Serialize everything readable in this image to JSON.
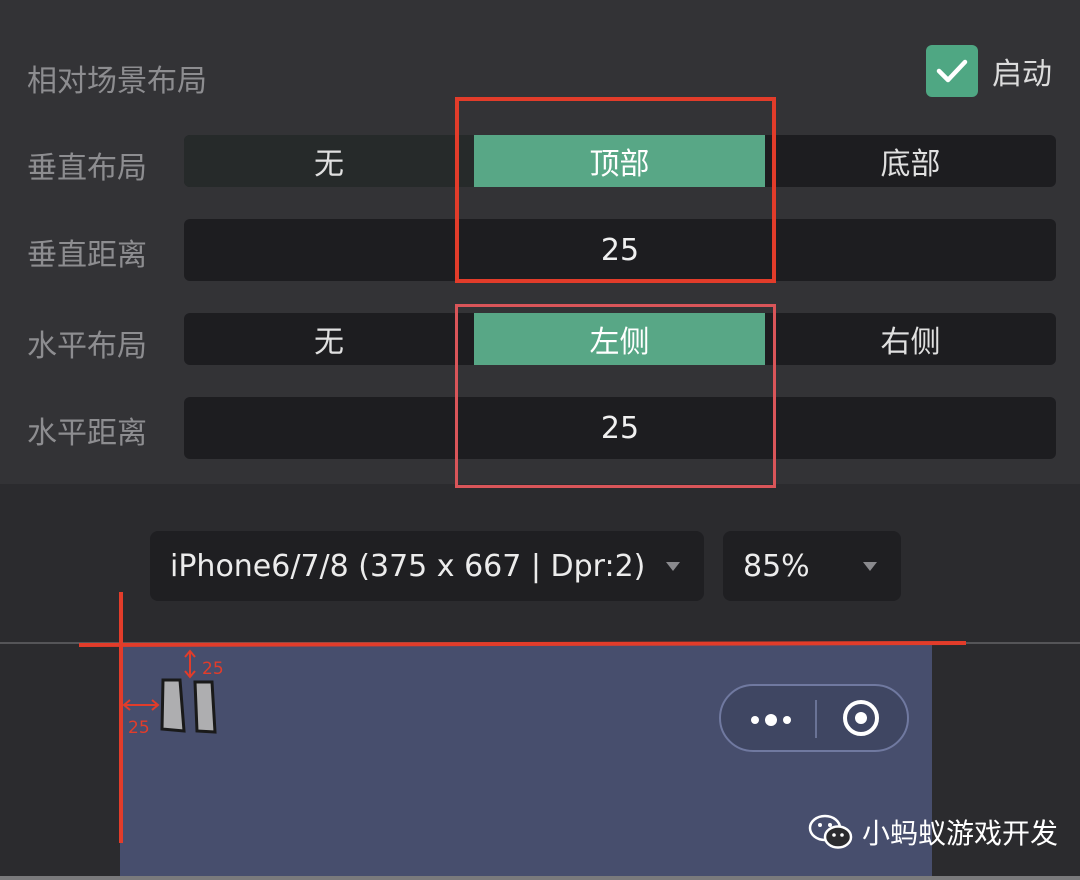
{
  "header": {
    "title": "相对场景布局",
    "enable_label": "启动",
    "enabled": true
  },
  "vertical_layout": {
    "label": "垂直布局",
    "options": [
      "无",
      "顶部",
      "底部"
    ],
    "selected": "顶部"
  },
  "vertical_distance": {
    "label": "垂直距离",
    "value": "25"
  },
  "horizontal_layout": {
    "label": "水平布局",
    "options": [
      "无",
      "左侧",
      "右侧"
    ],
    "selected": "左侧"
  },
  "horizontal_distance": {
    "label": "水平距离",
    "value": "25"
  },
  "toolbar": {
    "device": "iPhone6/7/8 (375 x 667 | Dpr:2)",
    "zoom": "85%"
  },
  "annotations": {
    "top_offset": "25",
    "left_offset": "25"
  },
  "watermark": "小蚂蚁游戏开发",
  "colors": {
    "accent": "#58a786",
    "annotation_red": "#e23c2a",
    "preview_bg": "#474e6d"
  }
}
